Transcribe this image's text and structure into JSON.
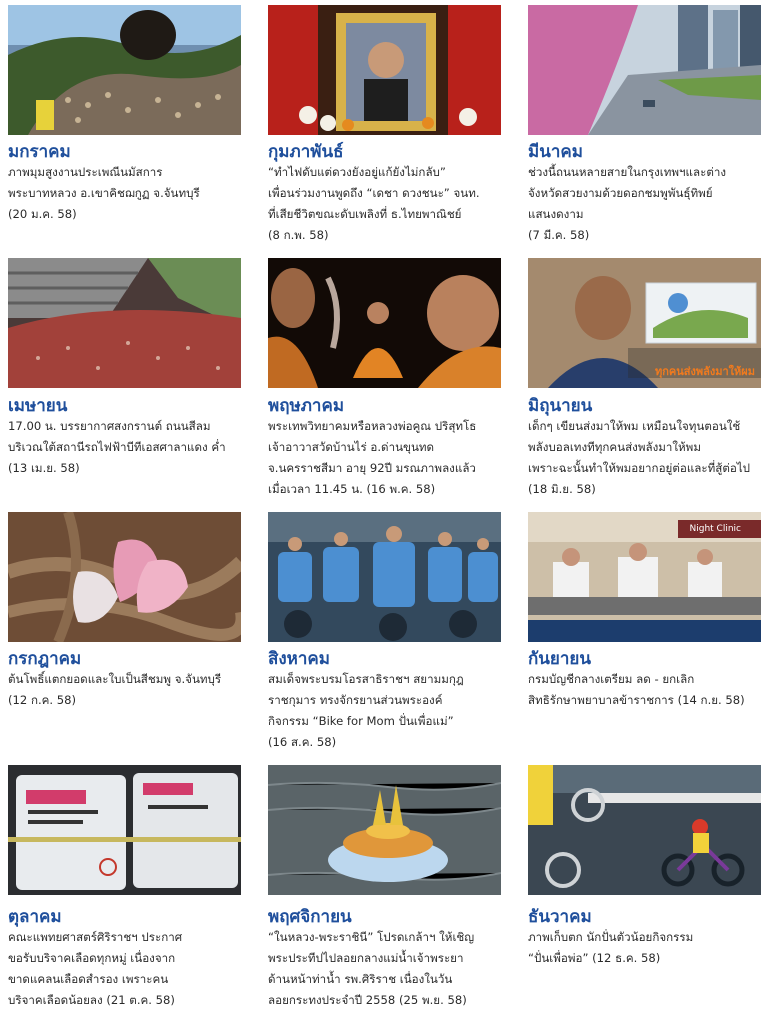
{
  "months": [
    {
      "name": "มกราคม",
      "desc": "ภาพมุมสูงงานประเพณีนมัสการ\nพระบาทหลวง อ.เขาคิชฌกูฏ จ.จันทบุรี\n(20 ม.ค. 58)",
      "image": "crowd-on-mountain-photo"
    },
    {
      "name": "กุมภาพันธ์",
      "desc": "“ทำไฟดับแต่ดวงยังอยู่แก้ยังไม่กลับ”\nเพื่อนร่วมงานพูดถึง “เดชา ดวงชนะ” จนท.\nที่เสียชีวิตขณะดับเพลิงที่ ธ.ไทยพาณิชย์\n(8 ก.พ. 58)",
      "image": "memorial-portrait-photo"
    },
    {
      "name": "มีนาคม",
      "desc": "ช่วงนี้ถนนหลายสายในกรุงเทพฯและต่าง\nจังหวัดสวยงามด้วยดอกชมพูพันธุ์ทิพย์\nแสนงดงาม\n(7 มี.ค. 58)",
      "image": "pink-blossom-road-photo"
    },
    {
      "name": "เมษายน",
      "desc": "17.00 น. บรรยากาศสงกรานต์ ถนนสีลม\nบริเวณใต้สถานีรถไฟฟ้าบีทีเอสศาลาแดง ค่ำ\n(13 เม.ย. 58)",
      "image": "songkran-crowd-photo"
    },
    {
      "name": "พฤษภาคม",
      "desc": "พระเทพวิทยาคมหรือหลวงพ่อคูณ ปริสุทโธ\nเจ้าอาวาสวัดบ้านไร่ อ.ด่านขุนทด\nจ.นครราชสีมา อายุ 92ปี มรณภาพลงแล้ว\nเมื่อเวลา 11.45 น. (16 พ.ค. 58)",
      "image": "monk-portrait-photo"
    },
    {
      "name": "มิถุนายน",
      "desc": "เด็กๆ เขียนส่งมาให้พม เหมือนใจทุนตอนใช้\nพลังบอลเทงทีทุกคนส่งพลังมาให้พม\nเพราะฉะนั้นทำให้พมอยากอยู่ต่อและที่สู้ต่อไป\n(18 มิ.ย. 58)",
      "image": "man-interview-photo",
      "caption": "ทุกคนส่งพลังมาให้ผม"
    },
    {
      "name": "กรกฎาคม",
      "desc": "ต้นโพธิ์แตกยอดและใบเป็นสีชมพู จ.จันทบุรี\n(12 ก.ค. 58)",
      "image": "pink-leaves-photo"
    },
    {
      "name": "สิงหาคม",
      "desc": "สมเด็จพระบรมโอรสาธิราชฯ สยามมกุฎ\nราชกุมาร ทรงจักรยานส่วนพระองค์\nกิจกรรม “Bike for Mom ปั่นเพื่อแม่”\n(16 ส.ค. 58)",
      "image": "cyclists-blue-shirts-photo"
    },
    {
      "name": "กันยายน",
      "desc": "กรมบัญชีกลางเตรียม ลด - ยกเลิก\nสิทธิรักษาพยาบาลข้าราชการ (14 ก.ย. 58)",
      "image": "hospital-nurses-photo",
      "caption": "Night Clinic"
    },
    {
      "name": "ตุลาคม",
      "desc": "คณะแพทยศาสตร์ศิริราชฯ ประกาศ\nขอรับบริจาคเลือดทุกหมู่ เนื่องจาก\nขาดแคลนเลือดสำรอง เพราะคน\nบริจาคเลือดน้อยลง (21 ต.ค. 58)",
      "image": "blood-bags-photo"
    },
    {
      "name": "พฤศจิกายน",
      "desc": "“ในหลวง-พระราชินี” โปรดเกล้าฯ ให้เชิญ\nพระประทีปไปลอยกลางแม่น้ำเจ้าพระยา\nด้านหน้าท่าน้ำ รพ.ศิริราช เนื่องในวัน\nลอยกระทงประจำปี 2558 (25 พ.ย. 58)",
      "image": "krathong-on-river-photo"
    },
    {
      "name": "ธันวาคม",
      "desc": "ภาพเก็บตก นักปั่นตัวน้อยกิจกรรม\n“ปั่นเพื่อพ่อ” (12 ธ.ค. 58)",
      "image": "child-cyclist-photo"
    }
  ]
}
